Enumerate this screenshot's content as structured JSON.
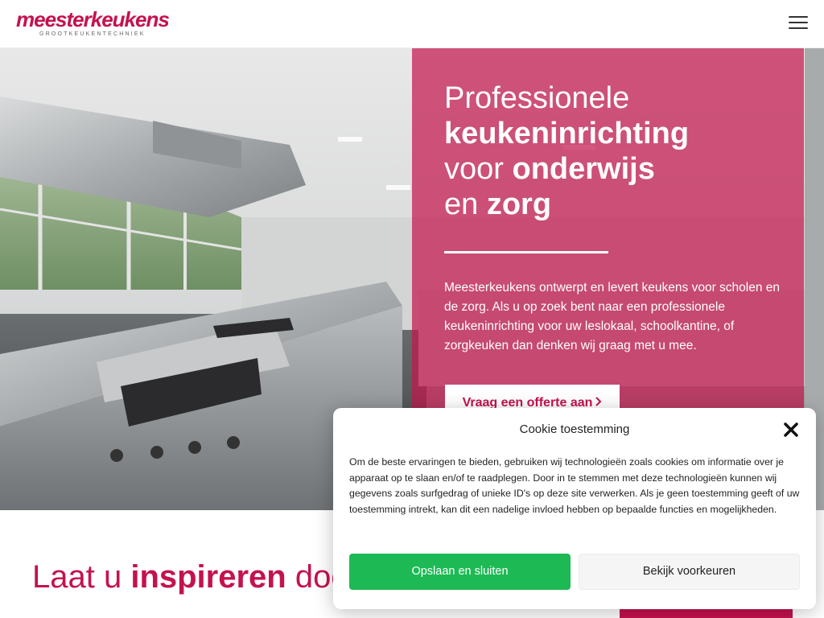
{
  "header": {
    "logo_text": "meesterkeukens",
    "logo_subtitle": "GROOTKEUKENTECHNIEK",
    "menu_icon": "hamburger-menu-icon"
  },
  "hero": {
    "headline": {
      "line1": "Professionele",
      "line2": "keukeninrichting",
      "line3_regular": "voor ",
      "line3_bold": "onderwijs",
      "line4_regular": "en ",
      "line4_bold": "zorg"
    },
    "intro": "Meesterkeukens ontwerpt en levert keukens voor scholen en de zorg. Als u op zoek bent naar een professionele keukeninrichting voor uw leslokaal, schoolkantine, of zorgkeuken dan denken wij graag met u mee.",
    "cta_label": "Vraag een offerte aan",
    "cta_icon": "chevron-right-icon",
    "overlay_color": "#c4174d"
  },
  "section": {
    "title_regular_1": "Laat u ",
    "title_bold": "inspireren",
    "title_regular_2": " door"
  },
  "cookie": {
    "title": "Cookie toestemming",
    "close_icon": "close-icon",
    "text": "Om de beste ervaringen te bieden, gebruiken wij technologieën zoals cookies om informatie over je apparaat op te slaan en/of te raadplegen. Door in te stemmen met deze technologieën kunnen wij gegevens zoals surfgedrag of unieke ID's op deze site verwerken. Als je geen toestemming geeft of uw toestemming intrekt, kan dit een nadelige invloed hebben op bepaalde functies en mogelijkheden.",
    "accept_label": "Opslaan en sluiten",
    "preferences_label": "Bekijk voorkeuren",
    "accept_color": "#1db954"
  },
  "brand": {
    "accent": "#c4124f"
  }
}
